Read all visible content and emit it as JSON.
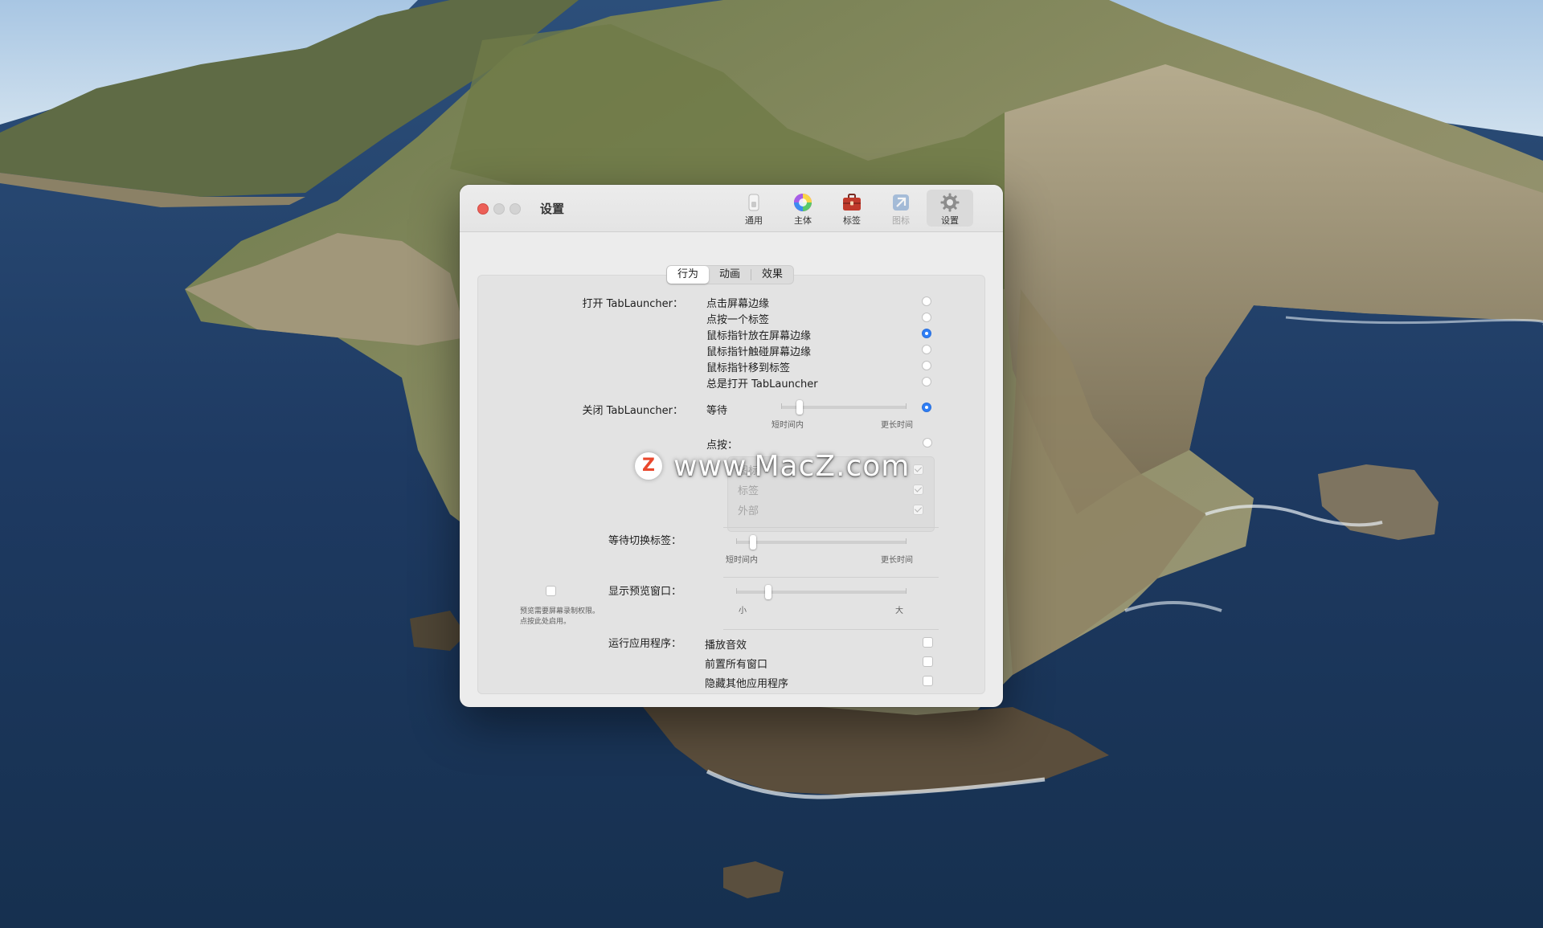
{
  "window": {
    "title": "设置"
  },
  "toolbar": {
    "items": [
      {
        "label": "通用",
        "icon": "switch-icon"
      },
      {
        "label": "主体",
        "icon": "color-wheel-icon"
      },
      {
        "label": "标签",
        "icon": "briefcase-icon"
      },
      {
        "label": "图标",
        "icon": "app-icon"
      },
      {
        "label": "设置",
        "icon": "gear-icon"
      }
    ]
  },
  "tabs": [
    "行为",
    "动画",
    "效果"
  ],
  "open_section": {
    "label": "打开 TabLauncher：",
    "options": [
      {
        "label": "点击屏幕边缘",
        "selected": false
      },
      {
        "label": "点按一个标签",
        "selected": false
      },
      {
        "label": "鼠标指针放在屏幕边缘",
        "selected": true
      },
      {
        "label": "鼠标指针触碰屏幕边缘",
        "selected": false
      },
      {
        "label": "鼠标指针移到标签",
        "selected": false
      },
      {
        "label": "总是打开 TabLauncher",
        "selected": false
      }
    ]
  },
  "close_section": {
    "label": "关闭 TabLauncher：",
    "wait_label": "等待",
    "wait_selected": true,
    "wait_slider": {
      "min_label": "短时间内",
      "max_label": "更长时间",
      "value": 0.15
    },
    "click_label": "点按：",
    "click_selected": false,
    "click_options": [
      {
        "label": "图标",
        "checked": true
      },
      {
        "label": "标签",
        "checked": true
      },
      {
        "label": "外部",
        "checked": true
      }
    ]
  },
  "switch_section": {
    "label": "等待切换标签：",
    "slider": {
      "min_label": "短时间内",
      "max_label": "更长时间",
      "value": 0.1
    }
  },
  "preview_section": {
    "label": "显示预览窗口：",
    "slider": {
      "min_label": "小",
      "max_label": "大",
      "value": 0.19
    },
    "note": "预览需要屏幕录制权限。\n点按此处启用。",
    "note_line1": "预览需要屏幕录制权限。",
    "note_line2": "点按此处启用。",
    "note_checked": false
  },
  "run_section": {
    "label": "运行应用程序：",
    "options": [
      {
        "label": "播放音效",
        "checked": false
      },
      {
        "label": "前置所有窗口",
        "checked": false
      },
      {
        "label": "隐藏其他应用程序",
        "checked": false
      }
    ]
  },
  "watermark": {
    "logo": "Z",
    "text": "www.MacZ.com"
  },
  "colors": {
    "accent": "#2f7ef5",
    "close": "#ec5f57",
    "window_bg": "#ececec"
  }
}
